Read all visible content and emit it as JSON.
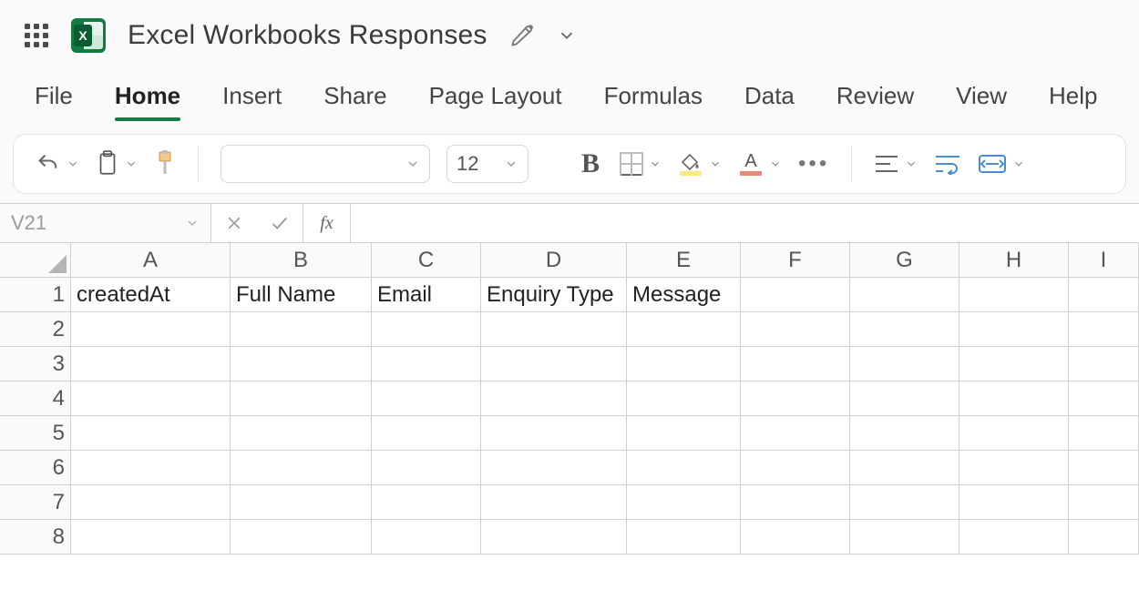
{
  "title": "Excel Workbooks Responses",
  "ribbon": {
    "tabs": [
      "File",
      "Home",
      "Insert",
      "Share",
      "Page Layout",
      "Formulas",
      "Data",
      "Review",
      "View",
      "Help"
    ],
    "active": "Home"
  },
  "toolbar": {
    "font_size": "12"
  },
  "fx": {
    "name_box": "V21",
    "fx_label": "fx",
    "formula": ""
  },
  "grid": {
    "columns": [
      "A",
      "B",
      "C",
      "D",
      "E",
      "F",
      "G",
      "H",
      "I"
    ],
    "row_numbers": [
      1,
      2,
      3,
      4,
      5,
      6,
      7,
      8
    ],
    "rows": [
      [
        "createdAt",
        "Full Name",
        "Email",
        "Enquiry Type",
        "Message",
        "",
        "",
        "",
        ""
      ],
      [
        "",
        "",
        "",
        "",
        "",
        "",
        "",
        "",
        ""
      ],
      [
        "",
        "",
        "",
        "",
        "",
        "",
        "",
        "",
        ""
      ],
      [
        "",
        "",
        "",
        "",
        "",
        "",
        "",
        "",
        ""
      ],
      [
        "",
        "",
        "",
        "",
        "",
        "",
        "",
        "",
        ""
      ],
      [
        "",
        "",
        "",
        "",
        "",
        "",
        "",
        "",
        ""
      ],
      [
        "",
        "",
        "",
        "",
        "",
        "",
        "",
        "",
        ""
      ],
      [
        "",
        "",
        "",
        "",
        "",
        "",
        "",
        "",
        ""
      ]
    ]
  }
}
